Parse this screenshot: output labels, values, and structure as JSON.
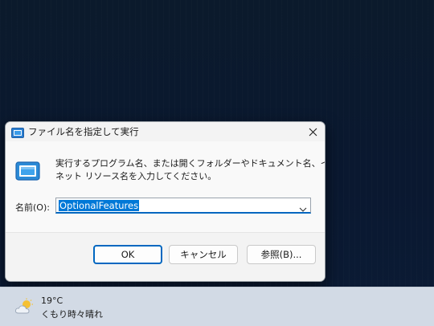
{
  "dialog": {
    "title": "ファイル名を指定して実行",
    "description_line1": "実行するプログラム名、または開くフォルダーやドキュメント名、インター",
    "description_line2": "ネット リソース名を入力してください。",
    "name_label": "名前(O):",
    "name_value": "OptionalFeatures",
    "buttons": {
      "ok": "OK",
      "cancel": "キャンセル",
      "browse": "参照(B)..."
    },
    "accent_color": "#0067c0"
  },
  "taskbar": {
    "weather": {
      "temperature": "19°C",
      "condition": "くもり時々晴れ",
      "icon": "partly-cloudy-icon"
    }
  },
  "icons": {
    "title_icon": "run-icon",
    "close": "close-icon",
    "dropdown": "chevron-down-icon"
  }
}
